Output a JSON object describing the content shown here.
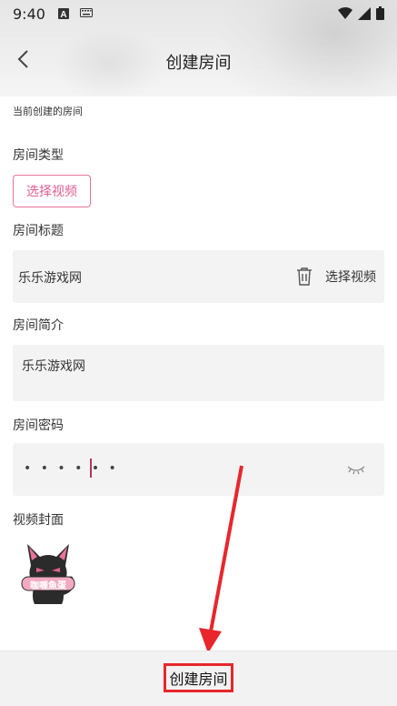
{
  "status_bar": {
    "time": "9:40",
    "icons": [
      "a-letter-icon",
      "keyboard-icon",
      "wifi-icon",
      "signal-icon",
      "battery-icon"
    ]
  },
  "nav": {
    "title": "创建房间",
    "back_icon": "chevron-left-icon"
  },
  "form": {
    "current_room_label": "当前创建的房间",
    "room_type": {
      "label": "房间类型",
      "button_label": "选择视频"
    },
    "room_title": {
      "label": "房间标题",
      "value": "乐乐游戏网",
      "action_label": "选择视频",
      "action_icon": "trash-icon"
    },
    "room_intro": {
      "label": "房间简介",
      "value": "乐乐游戏网"
    },
    "room_password": {
      "label": "房间密码",
      "masked_value": "• • • • • •",
      "toggle_icon": "eye-off-icon"
    },
    "video_cover": {
      "label": "视频封面",
      "cover_text": "咖喱魚蛋"
    }
  },
  "bottom": {
    "create_button_label": "创建房间"
  },
  "colors": {
    "accent_pink": "#e0608f",
    "annotation_red": "#e8262c",
    "field_bg": "#f3f3f3"
  }
}
